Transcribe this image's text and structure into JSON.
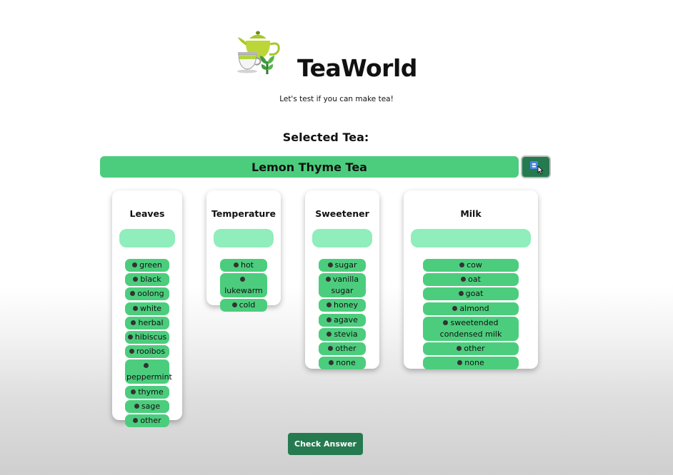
{
  "header": {
    "brand": "TeaWorld",
    "tagline": "Let's test if you can make tea!"
  },
  "selection": {
    "label": "Selected Tea:",
    "tea_name": "Lemon Thyme Tea"
  },
  "columns": [
    {
      "title": "Leaves",
      "options": [
        "green",
        "black",
        "oolong",
        "white",
        "herbal",
        "hibiscus",
        "rooibos",
        "peppermint",
        "thyme",
        "sage",
        "other"
      ]
    },
    {
      "title": "Temperature",
      "options": [
        "hot",
        "lukewarm",
        "cold"
      ]
    },
    {
      "title": "Sweetener",
      "options": [
        "sugar",
        "vanilla sugar",
        "honey",
        "agave",
        "stevia",
        "other",
        "none"
      ]
    },
    {
      "title": "Milk",
      "options": [
        "cow",
        "oat",
        "goat",
        "almond",
        "sweetended condensed milk",
        "other",
        "none"
      ]
    }
  ],
  "actions": {
    "check_answer": "Check Answer"
  },
  "colors": {
    "accent_green": "#4ccd7d",
    "dropzone_green": "#90edbc",
    "dark_green": "#257a4f"
  },
  "icons": {
    "logo": "teapot-cup-plant-icon",
    "shuffle": "shuffle-icon",
    "cursor": "hand-pointer-icon"
  }
}
